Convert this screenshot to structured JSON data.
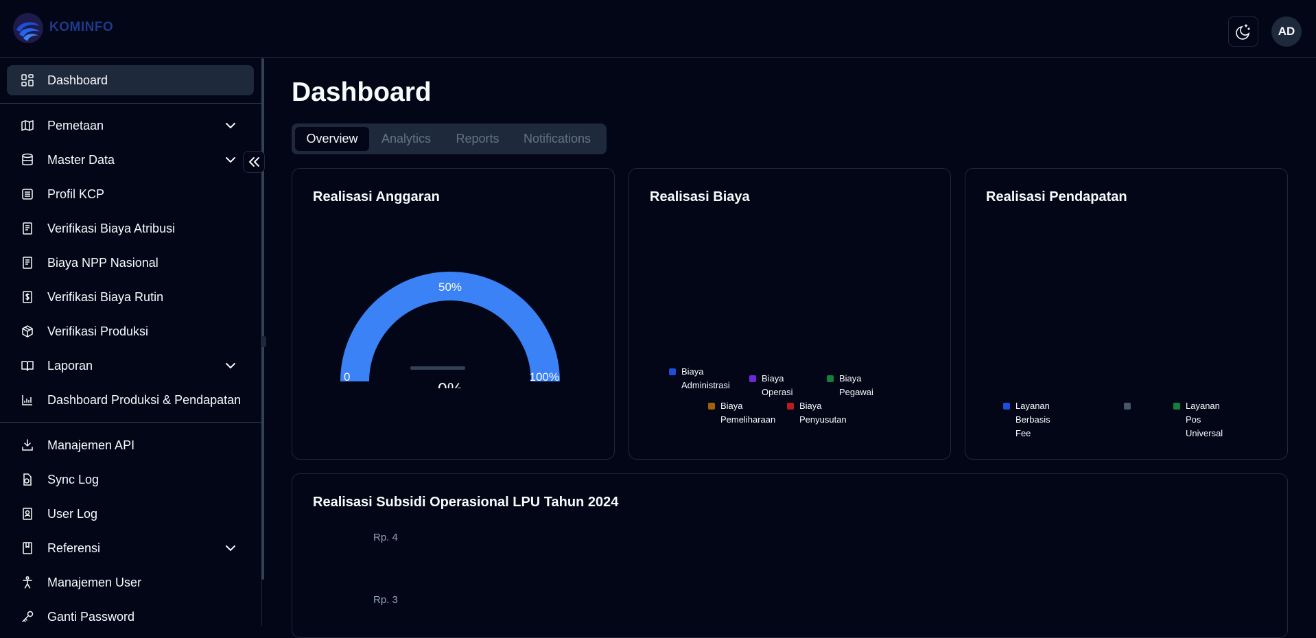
{
  "header": {
    "brand": "KOMINFO",
    "avatar_initials": "AD",
    "theme_icon": "moon-stars-icon"
  },
  "sidebar": {
    "items": [
      {
        "label": "Dashboard",
        "icon": "dashboard-icon",
        "active": true
      },
      {
        "label": "Pemetaan",
        "icon": "map-icon",
        "expandable": true
      },
      {
        "label": "Master Data",
        "icon": "database-icon",
        "expandable": true
      },
      {
        "label": "Profil KCP",
        "icon": "building-icon"
      },
      {
        "label": "Verifikasi Biaya Atribusi",
        "icon": "document-icon"
      },
      {
        "label": "Biaya NPP Nasional",
        "icon": "document-icon"
      },
      {
        "label": "Verifikasi Biaya Rutin",
        "icon": "dollar-file-icon"
      },
      {
        "label": "Verifikasi Produksi",
        "icon": "package-icon"
      },
      {
        "label": "Laporan",
        "icon": "book-icon",
        "expandable": true
      },
      {
        "label": "Dashboard Produksi & Pendapatan",
        "icon": "chart-icon"
      },
      {
        "label": "Manajemen API",
        "icon": "api-icon"
      },
      {
        "label": "Sync Log",
        "icon": "sync-file-icon"
      },
      {
        "label": "User Log",
        "icon": "user-file-icon"
      },
      {
        "label": "Referensi",
        "icon": "bookmark-book-icon",
        "expandable": true
      },
      {
        "label": "Manajemen User",
        "icon": "person-icon"
      },
      {
        "label": "Ganti Password",
        "icon": "key-icon"
      }
    ]
  },
  "main": {
    "title": "Dashboard",
    "tabs": [
      {
        "label": "Overview",
        "active": true
      },
      {
        "label": "Analytics"
      },
      {
        "label": "Reports"
      },
      {
        "label": "Notifications"
      }
    ]
  },
  "cards": {
    "anggaran": {
      "title": "Realisasi Anggaran",
      "gauge_color": "#3b82f6",
      "label_min": "0",
      "label_mid": "50%",
      "label_max": "100%",
      "value": "0%",
      "progress_fraction": 0
    },
    "biaya": {
      "title": "Realisasi Biaya",
      "legend": [
        {
          "line1": "Biaya",
          "line2": "Administrasi",
          "color": "#1d4ed8"
        },
        {
          "line1": "Biaya Operasi",
          "line2": "",
          "color": "#6d28d9"
        },
        {
          "line1": "Biaya Pegawai",
          "line2": "",
          "color": "#15803d"
        },
        {
          "line1": "Biaya",
          "line2": "Pemeliharaan",
          "color": "#a16207"
        },
        {
          "line1": "Biaya",
          "line2": "Penyusutan",
          "color": "#b91c1c"
        }
      ]
    },
    "pendapatan": {
      "title": "Realisasi Pendapatan",
      "legend": [
        {
          "line1": "Layanan",
          "line2": "Berbasis Fee",
          "color": "#1d4ed8"
        },
        {
          "line1": "",
          "line2": "",
          "color": "#475569"
        },
        {
          "line1": "Layanan Pos",
          "line2": "Universal",
          "color": "#15803d"
        }
      ]
    },
    "subsidi": {
      "title": "Realisasi Subsidi Operasional LPU Tahun 2024"
    }
  },
  "chart_data": {
    "type": "line",
    "title": "Realisasi Subsidi Operasional LPU Tahun 2024",
    "yticks": [
      "Rp. 4",
      "Rp. 3"
    ],
    "series": []
  }
}
